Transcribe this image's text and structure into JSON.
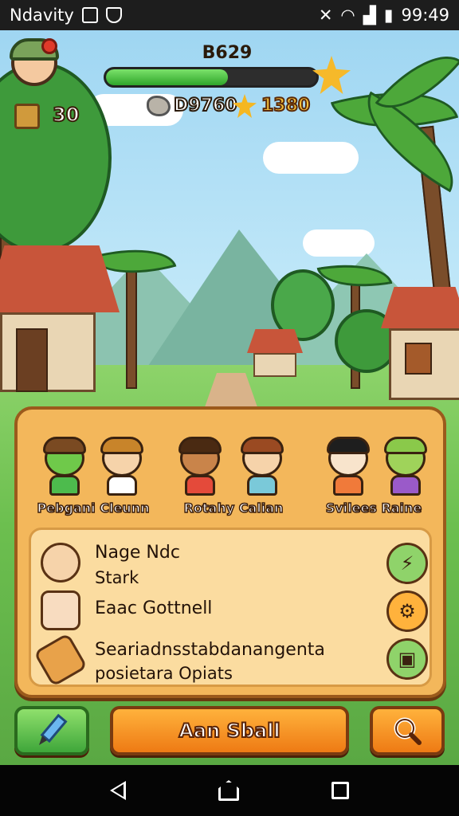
{
  "status_bar": {
    "app_name": "Ndavity",
    "time": "99:49",
    "left_icons": [
      "image-icon",
      "shield-icon"
    ],
    "right_icons": [
      "mute-icon",
      "wifi-icon",
      "signal-icon",
      "battery-icon"
    ]
  },
  "hud": {
    "level_text": "B629",
    "xp_progress": 0.58,
    "crate_count": "30",
    "ore_count": "D9760",
    "coin_count": "1380",
    "colors": {
      "xp_fill": "#3fb53a",
      "coin": "#f6c23a"
    }
  },
  "groups": [
    {
      "label": "Pebgani Cleunn",
      "chars": [
        "green",
        "human"
      ]
    },
    {
      "label": "Rotahy Calian",
      "chars": [
        "human",
        "human"
      ]
    },
    {
      "label": "Svilees Raine",
      "chars": [
        "human",
        "green"
      ]
    }
  ],
  "list_items": [
    {
      "title": "Nage Ndc",
      "subtitle": "Stark",
      "icon": "child-portrait-icon",
      "action_icon": "lightning-icon",
      "action_color": "#8fd36a"
    },
    {
      "title": "Eaac Gottnell",
      "subtitle": "",
      "icon": "cat-face-icon",
      "action_icon": "gear-icon",
      "action_color": "#ffb23c"
    },
    {
      "title": "Seariadnsstabdanangenta",
      "subtitle": "posietara Opiats",
      "icon": "scroll-icon",
      "action_icon": "note-icon",
      "action_color": "#8fd36a"
    }
  ],
  "buttons": {
    "main_label": "Aan Sball",
    "edit_icon": "pencil-icon",
    "search_icon": "search-icon"
  },
  "navbar": [
    "back-icon",
    "home-icon",
    "recents-icon"
  ]
}
